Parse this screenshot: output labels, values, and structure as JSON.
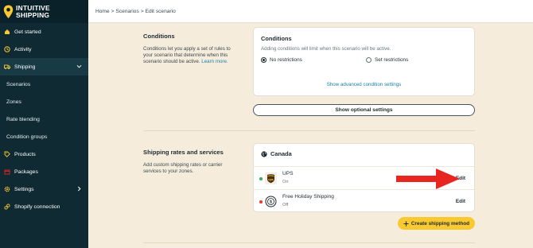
{
  "brand": {
    "line1": "INTUITIVE",
    "line2": "SHIPPING"
  },
  "sidebar": {
    "items": [
      {
        "label": "Get started",
        "icon": "home-icon"
      },
      {
        "label": "Activity",
        "icon": "activity-icon"
      },
      {
        "label": "Shipping",
        "icon": "truck-icon"
      },
      {
        "label": "Scenarios"
      },
      {
        "label": "Zones"
      },
      {
        "label": "Rate blending"
      },
      {
        "label": "Condition groups"
      },
      {
        "label": "Products",
        "icon": "tag-icon"
      },
      {
        "label": "Packages",
        "icon": "box-icon"
      },
      {
        "label": "Settings",
        "icon": "gear-icon"
      },
      {
        "label": "Shopify connection",
        "icon": "link-icon"
      }
    ]
  },
  "breadcrumb": {
    "home": "Home",
    "scenarios": "Scenarios",
    "current": "Edit scenario",
    "separator": ">"
  },
  "conditions": {
    "section_title": "Conditions",
    "section_desc": "Conditions let you apply a set of rules to your scenario that determine when this scenario should be active.",
    "learn_more": "Learn more.",
    "card_title": "Conditions",
    "card_desc": "Adding conditions will limit when this scenario will be active.",
    "option_none": "No restrictions",
    "option_set": "Set restrictions",
    "advanced_link": "Show advanced condition settings"
  },
  "optional_settings_button": "Show optional settings",
  "shipping": {
    "section_title": "Shipping rates and services",
    "section_desc": "Add custom shipping rates or carrier services to your zones.",
    "country": "Canada",
    "methods": [
      {
        "name": "UPS",
        "status": "On",
        "edit": "Edit",
        "status_color": "#3fae5a"
      },
      {
        "name": "Free Holiday Shipping",
        "status": "Off",
        "edit": "Edit",
        "status_color": "#e0413a"
      }
    ],
    "create_button": "Create shipping method"
  },
  "colors": {
    "sidebar": "#0f2a33",
    "accent_yellow": "#f9c932",
    "arrow_red": "#e8261f",
    "link": "#1a7fa8"
  }
}
